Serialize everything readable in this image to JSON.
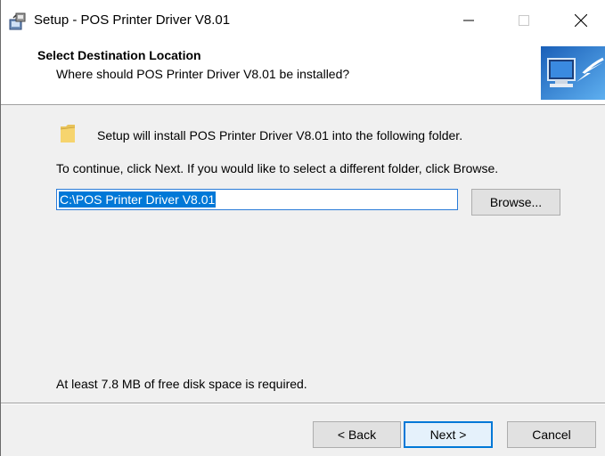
{
  "window": {
    "title": "Setup - POS Printer Driver V8.01",
    "icon": "setup-installer-icon",
    "controls": [
      "minimize-icon",
      "maximize-icon",
      "close-icon"
    ]
  },
  "header": {
    "title": "Select Destination Location",
    "subtitle": "Where should POS Printer Driver V8.01 be installed?",
    "image": "computer-install-arrow-icon"
  },
  "body": {
    "intro": "Setup will install POS Printer Driver V8.01 into the following folder.",
    "continue_text": "To continue, click Next. If you would like to select a different folder, click Browse.",
    "path_value": "C:\\POS Printer Driver V8.01",
    "browse_label": "Browse...",
    "disk_space": "At least 7.8 MB of free disk space is required."
  },
  "footer": {
    "back_label": "< Back",
    "next_label": "Next >",
    "cancel_label": "Cancel"
  },
  "colors": {
    "accent": "#0078d7",
    "selection": "#0078d7",
    "window_bg": "#f0f0f0"
  }
}
